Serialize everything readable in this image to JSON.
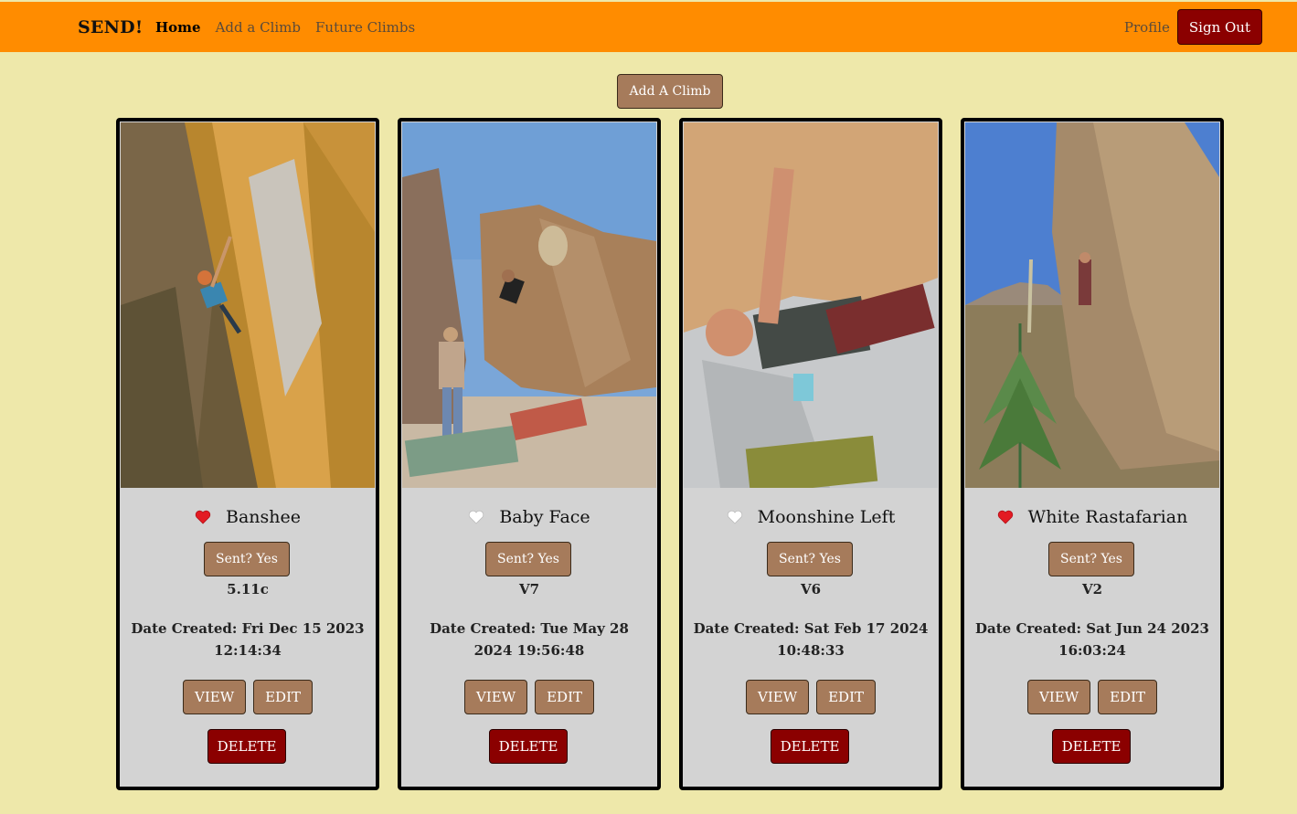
{
  "navbar": {
    "brand": "SEND!",
    "links": [
      {
        "label": "Home",
        "active": true
      },
      {
        "label": "Add a Climb",
        "active": false
      },
      {
        "label": "Future Climbs",
        "active": false
      }
    ],
    "profile_label": "Profile",
    "signout_label": "Sign Out",
    "bg_color": "#ff8c00"
  },
  "add_climb_label": "Add A Climb",
  "colors": {
    "page_bg": "#eee8aa",
    "card_bg": "#d3d3d3",
    "button_brown": "#a67b5b",
    "delete_red": "#8b0000",
    "heart_red": "#e31b23"
  },
  "climbs": [
    {
      "name": "Banshee",
      "favorited": true,
      "sent_label": "Sent? Yes",
      "grade": "5.11c",
      "date_label": "Date Created: Fri Dec 15 2023 12:14:34",
      "view_label": "VIEW",
      "edit_label": "EDIT",
      "delete_label": "DELETE",
      "photo_icon": "climber-on-orange-rock-face-photo"
    },
    {
      "name": "Baby Face",
      "favorited": false,
      "sent_label": "Sent? Yes",
      "grade": "V7",
      "date_label": "Date Created: Tue May 28 2024 19:56:48",
      "view_label": "VIEW",
      "edit_label": "EDIT",
      "delete_label": "DELETE",
      "photo_icon": "boulder-with-spotter-photo"
    },
    {
      "name": "Moonshine Left",
      "favorited": false,
      "sent_label": "Sent? Yes",
      "grade": "V6",
      "date_label": "Date Created: Sat Feb 17 2024 10:48:33",
      "view_label": "VIEW",
      "edit_label": "EDIT",
      "delete_label": "DELETE",
      "photo_icon": "climber-under-overhang-photo"
    },
    {
      "name": "White Rastafarian",
      "favorited": true,
      "sent_label": "Sent? Yes",
      "grade": "V2",
      "date_label": "Date Created: Sat Jun 24 2023 16:03:24",
      "view_label": "VIEW",
      "edit_label": "EDIT",
      "delete_label": "DELETE",
      "photo_icon": "desert-boulder-with-yucca-photo"
    }
  ]
}
